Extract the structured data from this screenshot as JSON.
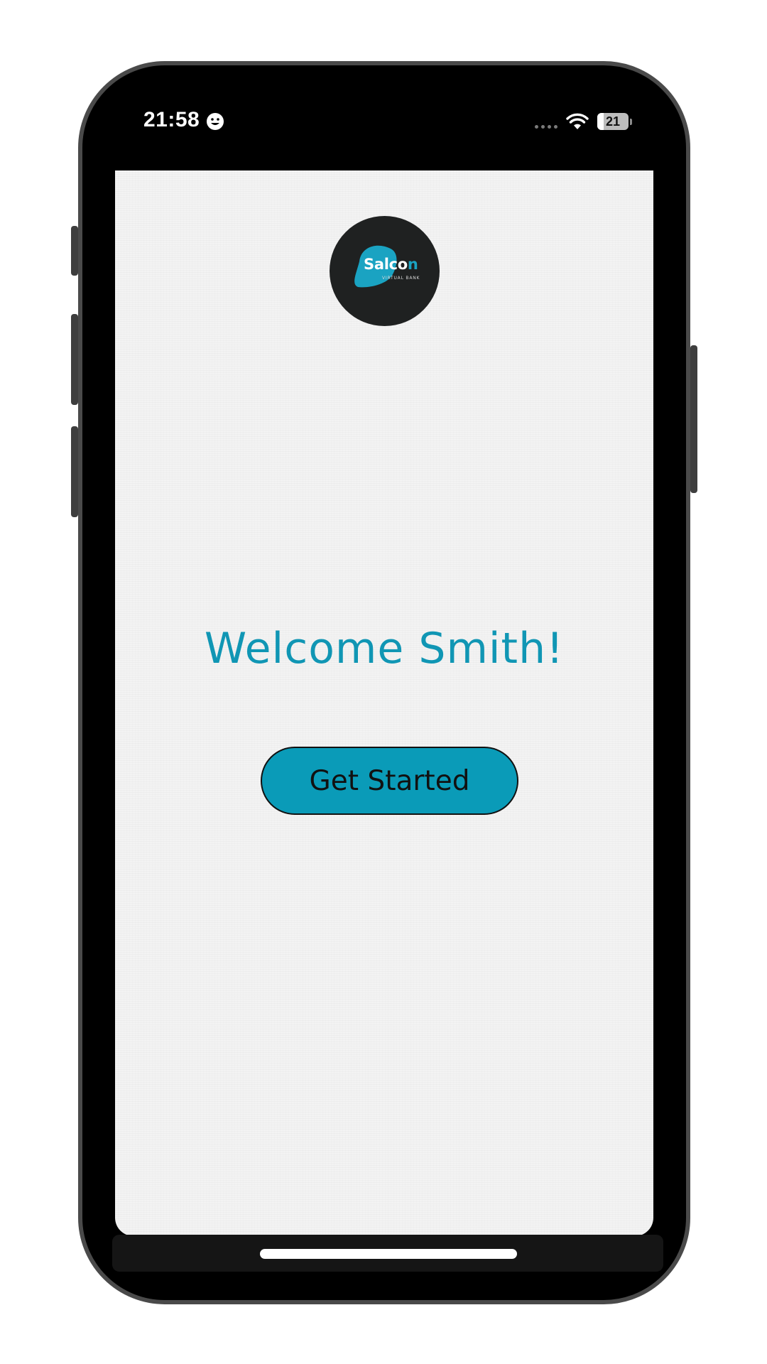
{
  "status_bar": {
    "time": "21:58",
    "battery_percent": "21",
    "battery_level": 0.21
  },
  "logo": {
    "brand_main": "Salco",
    "brand_accent": "n",
    "tagline": "VIRTUAL BANK"
  },
  "main": {
    "welcome_text": "Welcome Smith!",
    "cta_label": "Get Started"
  },
  "colors": {
    "accent": "#0a9bb8",
    "welcome_text": "#1096b4",
    "screen_background": "#f3f3f3",
    "logo_background": "#1f2121"
  },
  "icons": {
    "status_emoji": "smiley-face-icon",
    "signal": "cellular-signal-icon",
    "wifi": "wifi-icon",
    "battery": "battery-icon"
  }
}
